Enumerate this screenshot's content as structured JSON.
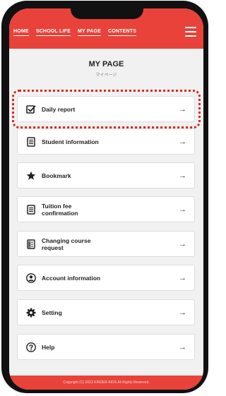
{
  "nav": {
    "links": [
      "HOME",
      "SCHOOL LIFE",
      "MY PAGE",
      "CONTENTS"
    ]
  },
  "page": {
    "title": "MY PAGE",
    "subtitle": "マイページ"
  },
  "menu": [
    {
      "label": "Daily report",
      "icon": "checkbox-icon",
      "arrow": "→"
    },
    {
      "label": "Student information",
      "icon": "document-icon",
      "arrow": "→"
    },
    {
      "label": "Bookmark",
      "icon": "star-icon",
      "arrow": "→"
    },
    {
      "label": "Tuition fee\nconfirmation",
      "icon": "document-icon",
      "arrow": "→"
    },
    {
      "label": "Changing course\nrequest",
      "icon": "checklist-icon",
      "arrow": "→"
    },
    {
      "label": "Account information",
      "icon": "user-circle-icon",
      "arrow": "→"
    },
    {
      "label": "Setting",
      "icon": "gear-icon",
      "arrow": "→"
    },
    {
      "label": "Help",
      "icon": "help-circle-icon",
      "arrow": "→"
    }
  ],
  "footer": {
    "copyright": "Copyright (C) 2023 KINDER-KIDS All Rights Reserved."
  },
  "colors": {
    "brand": "#e8423a",
    "highlight": "#e0211b",
    "background": "#f1f1f1"
  }
}
